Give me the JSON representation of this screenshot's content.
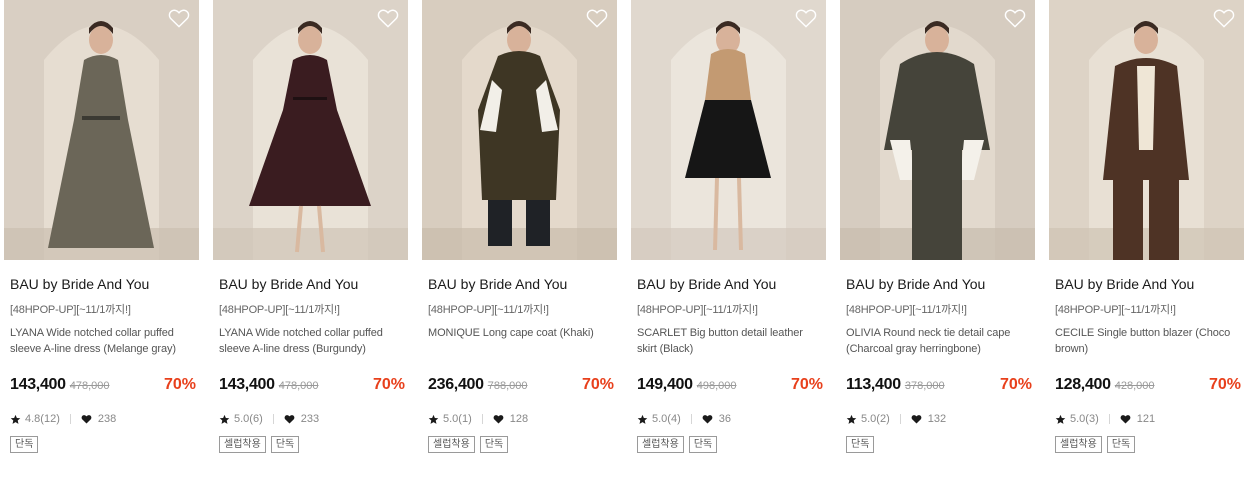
{
  "colors": {
    "discount": "#e8401c",
    "text_primary": "#111111",
    "muted": "#888888"
  },
  "icons": {
    "wishlist": "heart-outline-icon",
    "rating": "star-icon",
    "likes": "heart-filled-icon"
  },
  "products": [
    {
      "brand": "BAU by Bride And You",
      "promo": "[48HPOP-UP][~11/1까지!]",
      "name": "LYANA Wide notched collar puffed sleeve A-line dress (Melange gray)",
      "price": "143,400",
      "original_price": "478,000",
      "discount": "70%",
      "rating": "4.8(12)",
      "likes": "238",
      "tags": [
        "단독"
      ],
      "image_colors": {
        "bg": "#d9cfc3",
        "arch": "#e6ddd1",
        "garment": "#6b6658",
        "accent": "#3b3a33",
        "floor": "#cbbfb1"
      }
    },
    {
      "brand": "BAU by Bride And You",
      "promo": "[48HPOP-UP][~11/1까지!]",
      "name": "LYANA Wide notched collar puffed sleeve A-line dress (Burgundy)",
      "price": "143,400",
      "original_price": "478,000",
      "discount": "70%",
      "rating": "5.0(6)",
      "likes": "233",
      "tags": [
        "셀럽착용",
        "단독"
      ],
      "image_colors": {
        "bg": "#dcd3c8",
        "arch": "#e9e2d7",
        "garment": "#3a1c20",
        "accent": "#1e1012",
        "floor": "#cec4b7"
      }
    },
    {
      "brand": "BAU by Bride And You",
      "promo": "[48HPOP-UP][~11/1까지!]",
      "name": "MONIQUE Long cape coat (Khaki)",
      "price": "236,400",
      "original_price": "788,000",
      "discount": "70%",
      "rating": "5.0(1)",
      "likes": "128",
      "tags": [
        "셀럽착용",
        "단독"
      ],
      "image_colors": {
        "bg": "#d8cdbf",
        "arch": "#e4d9cb",
        "garment": "#3e3624",
        "accent": "#f2efe8",
        "floor": "#c9bcab"
      }
    },
    {
      "brand": "BAU by Bride And You",
      "promo": "[48HPOP-UP][~11/1까지!]",
      "name": "SCARLET Big button detail leather skirt (Black)",
      "price": "149,400",
      "original_price": "498,000",
      "discount": "70%",
      "rating": "5.0(4)",
      "likes": "36",
      "tags": [
        "셀럽착용",
        "단독"
      ],
      "image_colors": {
        "bg": "#e0d8ce",
        "arch": "#ebe5dc",
        "garment": "#161616",
        "accent": "#c39a72",
        "floor": "#d3c9bd"
      }
    },
    {
      "brand": "BAU by Bride And You",
      "promo": "[48HPOP-UP][~11/1까지!]",
      "name": "OLIVIA Round neck tie detail cape (Charcoal gray herringbone)",
      "price": "113,400",
      "original_price": "378,000",
      "discount": "70%",
      "rating": "5.0(2)",
      "likes": "132",
      "tags": [
        "단독"
      ],
      "image_colors": {
        "bg": "#d6ccc0",
        "arch": "#e2d9cd",
        "garment": "#45443a",
        "accent": "#f4f1ea",
        "floor": "#c8bcae"
      }
    },
    {
      "brand": "BAU by Bride And You",
      "promo": "[48HPOP-UP][~11/1까지!]",
      "name": "CECILE Single button blazer (Choco brown)",
      "price": "128,400",
      "original_price": "428,000",
      "discount": "70%",
      "rating": "5.0(3)",
      "likes": "121",
      "tags": [
        "셀럽착용",
        "단독"
      ],
      "image_colors": {
        "bg": "#ddd3c6",
        "arch": "#e8e0d4",
        "garment": "#4e3325",
        "accent": "#efe6d6",
        "floor": "#cfc3b4"
      }
    }
  ]
}
